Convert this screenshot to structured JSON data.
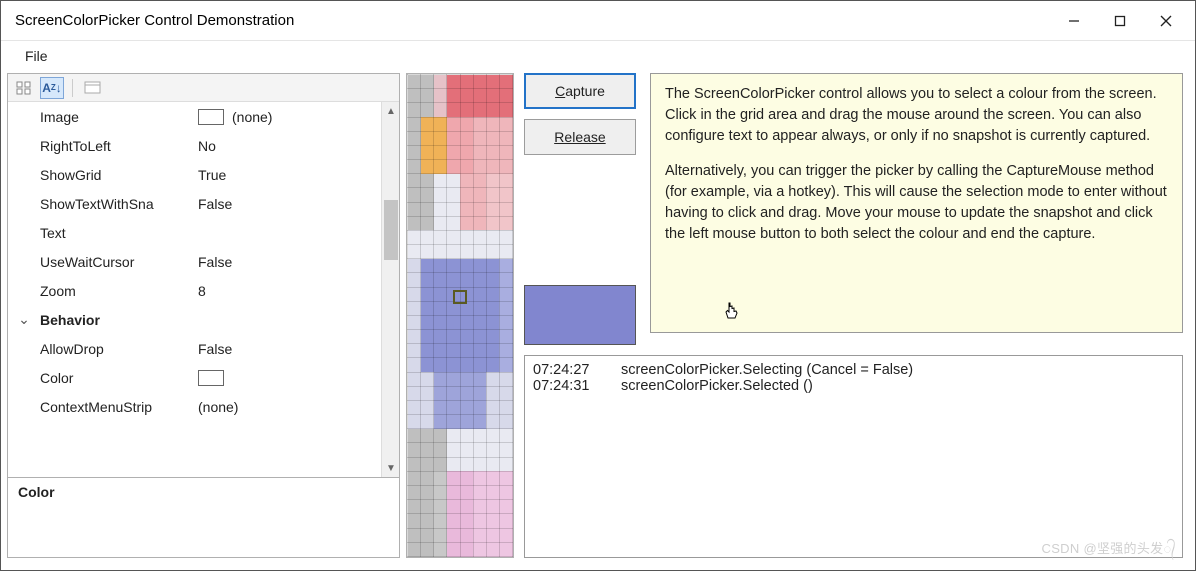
{
  "window": {
    "title": "ScreenColorPicker Control Demonstration"
  },
  "menu": {
    "file": "File"
  },
  "propgrid": {
    "rows": [
      {
        "name": "Image",
        "value": "(none)",
        "swatch": true
      },
      {
        "name": "RightToLeft",
        "value": "No"
      },
      {
        "name": "ShowGrid",
        "value": "True"
      },
      {
        "name": "ShowTextWithSna",
        "value": "False"
      },
      {
        "name": "Text",
        "value": ""
      },
      {
        "name": "UseWaitCursor",
        "value": "False"
      },
      {
        "name": "Zoom",
        "value": "8"
      },
      {
        "name": "Behavior",
        "value": "",
        "category": true
      },
      {
        "name": "AllowDrop",
        "value": "False"
      },
      {
        "name": "Color",
        "value": "",
        "swatch": true
      },
      {
        "name": "ContextMenuStrip",
        "value": "(none)"
      }
    ],
    "help_title": "Color"
  },
  "buttons": {
    "capture": "Capture",
    "release": "Release"
  },
  "color_preview": "#8186cf",
  "info": {
    "p1": "The ScreenColorPicker control allows you to select a colour from the screen. Click in the grid area and drag the mouse around the screen. You can also configure text to appear always, or only if no snapshot is currently captured.",
    "p2": "Alternatively, you can trigger the picker by calling the CaptureMouse method (for example, via a hotkey). This will cause the selection mode to enter without having to click and drag. Move your mouse to update the snapshot and click the left mouse button to both select the colour and end the capture."
  },
  "log": [
    {
      "time": "07:24:27",
      "msg": "screenColorPicker.Selecting (Cancel = False)"
    },
    {
      "time": "07:24:31",
      "msg": "screenColorPicker.Selected ()"
    }
  ],
  "watermark": "CSDN @坚强的头发᭄"
}
